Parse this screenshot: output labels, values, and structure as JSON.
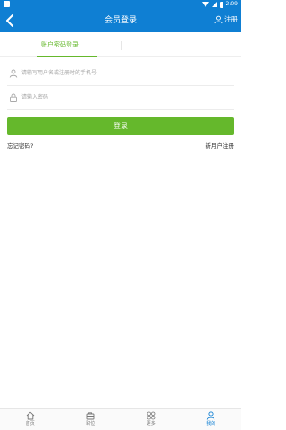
{
  "status_bar": {
    "time": "2:09"
  },
  "header": {
    "title": "会员登录",
    "register_label": "注册"
  },
  "tabs": {
    "active_label": "账户密码登录"
  },
  "form": {
    "username_placeholder": "请输写用户名或注册时的手机号",
    "password_placeholder": "请输入密码",
    "submit_label": "登录",
    "forgot_label": "忘记密码?",
    "new_user_label": "新用户注册"
  },
  "colors": {
    "primary": "#0f7fd3",
    "accent": "#65b82c"
  },
  "bottom_nav": {
    "items": [
      {
        "label": "首页",
        "icon": "home-icon"
      },
      {
        "label": "职位",
        "icon": "briefcase-icon"
      },
      {
        "label": "更多",
        "icon": "grid-icon"
      },
      {
        "label": "我的",
        "icon": "person-icon",
        "active": true
      }
    ]
  }
}
